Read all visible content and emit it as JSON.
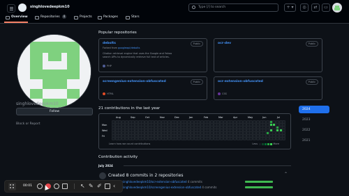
{
  "header": {
    "username": "singhlovedeepkm10",
    "search_placeholder": "Type [/] to search",
    "plus_label": "+ ▾"
  },
  "tabs": [
    {
      "label": "Overview",
      "icon": "book-icon",
      "active": true
    },
    {
      "label": "Repositories",
      "icon": "repo-icon",
      "count": "4"
    },
    {
      "label": "Projects",
      "icon": "table-icon"
    },
    {
      "label": "Packages",
      "icon": "package-icon"
    },
    {
      "label": "Stars",
      "icon": "star-icon"
    }
  ],
  "profile": {
    "name": "singhlovedeepkm10",
    "follow_label": "Follow",
    "block_label": "Block or Report"
  },
  "popular": {
    "title": "Popular repositories",
    "repos": [
      {
        "name": "debolts",
        "badge": "Public",
        "fork_prefix": "Forked from",
        "fork_source": "googleapi/debolts",
        "description": "Citation retrieval engine that uses the Google and Yahoo search APIs to dynamically retrieve full text of articles.",
        "language": "PHP",
        "lang_color": "#4f5d95"
      },
      {
        "name": "ocr-dev",
        "badge": "Public",
        "language": "",
        "lang_color": ""
      },
      {
        "name": "screengenius-extension-obfuscated",
        "badge": "Public",
        "language": "HTML",
        "lang_color": "#e34c26"
      },
      {
        "name": "ocr-extension-obfuscated",
        "badge": "Public",
        "language": "CSS",
        "lang_color": "#663399"
      }
    ]
  },
  "contributions": {
    "title": "21 contributions in the last year",
    "months": [
      "Aug",
      "Sep",
      "Oct",
      "Nov",
      "Dec",
      "Jan",
      "Feb",
      "Mar",
      "Apr",
      "May",
      "Jun",
      "Jul"
    ],
    "days": [
      "Mon",
      "Wed",
      "Fri"
    ],
    "learn_label": "Learn how we count contributions",
    "less_label": "Less",
    "more_label": "More",
    "active_cells": [
      [
        48,
        0
      ],
      [
        48,
        1
      ],
      [
        50,
        2
      ],
      [
        50,
        3
      ],
      [
        51,
        3
      ],
      [
        47,
        4
      ],
      [
        49,
        1
      ],
      [
        48,
        3
      ]
    ]
  },
  "years": [
    "2024",
    "2023",
    "2022",
    "2021"
  ],
  "activity": {
    "title": "Contribution activity",
    "month": "July 2024",
    "summary": "Created 8 commits in 2 repositories",
    "repos": [
      {
        "name": "singhlovedeepkm10/ocr-extension-obfuscated",
        "commits": "4 commits",
        "share": 0.5
      },
      {
        "name": "singhlovedeepkm10/screengenius-extension-obfuscated",
        "commits": "4 commits",
        "share": 0.5
      }
    ]
  },
  "recorder": {
    "timer": "00:01"
  }
}
